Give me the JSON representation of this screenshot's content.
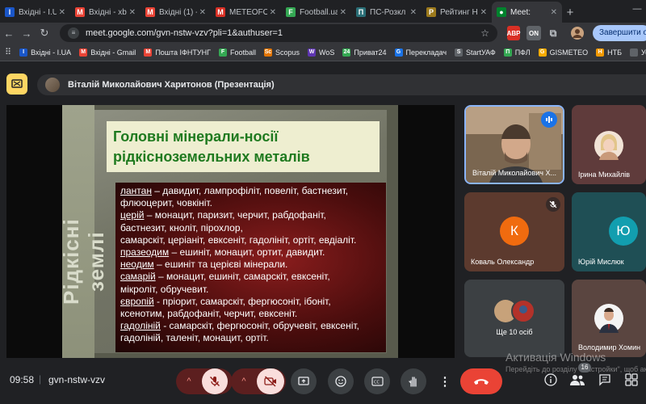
{
  "browser": {
    "tabs": [
      {
        "label": "Вхідні - I.UA",
        "icon_text": "I",
        "color": "#1a56c8"
      },
      {
        "label": "Вхідні - xb",
        "icon_text": "M",
        "color": "#ea4335"
      },
      {
        "label": "Вхідні (1) -",
        "icon_text": "M",
        "color": "#ea4335"
      },
      {
        "label": "METEOFOR",
        "icon_text": "M",
        "color": "#d93025"
      },
      {
        "label": "Football.ua",
        "icon_text": "F",
        "color": "#34a853"
      },
      {
        "label": "ПС-Розкл",
        "icon_text": "П",
        "color": "#2a6f77"
      },
      {
        "label": "Рейтинг НП",
        "icon_text": "Р",
        "color": "#9c7a1c"
      },
      {
        "label": "Meet: ",
        "icon_text": "●",
        "color": "#00832d"
      }
    ],
    "new_tab": "+",
    "url": "meet.google.com/gvn-nstw-vzv?pli=1&authuser=1",
    "end_call_pill": "Завершити онлайн",
    "extensions": [
      "ABP",
      "ON"
    ],
    "bookmarks": [
      {
        "label": "Вхідні - I.UA",
        "icon_text": "I",
        "color": "#1a56c8"
      },
      {
        "label": "Вхідні - Gmail",
        "icon_text": "M",
        "color": "#ea4335"
      },
      {
        "label": "Пошта ІФНТУНГ",
        "icon_text": "M",
        "color": "#ea4335"
      },
      {
        "label": "Football",
        "icon_text": "F",
        "color": "#34a853"
      },
      {
        "label": "Scopus",
        "icon_text": "Sc",
        "color": "#e37400"
      },
      {
        "label": "WoS",
        "icon_text": "W",
        "color": "#5e35b1"
      },
      {
        "label": "Приват24",
        "icon_text": "24",
        "color": "#34a853"
      },
      {
        "label": "Перекладач",
        "icon_text": "G",
        "color": "#1a73e8"
      },
      {
        "label": "StartУАФ",
        "icon_text": "S",
        "color": "#5f6368"
      },
      {
        "label": "ПФЛ",
        "icon_text": "П",
        "color": "#34a853"
      },
      {
        "label": "GISMETEO",
        "icon_text": "G",
        "color": "#f9ab00"
      },
      {
        "label": "НТБ",
        "icon_text": "Н",
        "color": "#f29900"
      },
      {
        "label": "Ус",
        "icon_text": "",
        "color": "#5f6368"
      }
    ]
  },
  "meet": {
    "presenter_label": "Віталій Миколайович Харитонов (Презентація)",
    "slide": {
      "side_title": "Рідкісні землі",
      "title": "Головні мінерали-носії рідкісноземельних металів",
      "lines": [
        {
          "u": "лантан",
          "t": " – давидит, лампрофіліт, повеліт, бастнезит,"
        },
        {
          "u": "",
          "t": "флюоцерит, човкініт."
        },
        {
          "u": "церій",
          "t": " – монацит, паризит, черчит, рабдофаніт,"
        },
        {
          "u": "",
          "t": "бастнезит, кноліт, пірохлор,"
        },
        {
          "u": "",
          "t": "самарскіт, церіаніт, евксеніт, гадолініт, ортіт, евдіаліт."
        },
        {
          "u": "празеодим",
          "t": " – ешиніт, монацит, ортит, давидит."
        },
        {
          "u": "неодим",
          "t": " – ешиніт та церієві мінерали."
        },
        {
          "u": "самарій",
          "t": " – монацит, ешиніт, самарскіт, евксеніт,"
        },
        {
          "u": "",
          "t": "мікроліт, обручевит."
        },
        {
          "u": "європій",
          "t": " - пріорит, самарскіт, фергюсоніт, ібоніт,"
        },
        {
          "u": "",
          "t": "ксенотим, рабдофаніт, черчит, евксеніт."
        },
        {
          "u": "гадоліній",
          "t": " - самарскіт, фергюсоніт, обручевіт, евксеніт,"
        },
        {
          "u": "",
          "t": "гадоліній, таленіт, монацит, ортіт."
        }
      ]
    },
    "participants": [
      {
        "name": "Віталій Миколайович Х...",
        "type": "video",
        "speaking": true
      },
      {
        "name": "Ірина Михайлів",
        "type": "photo"
      },
      {
        "name": "Коваль Олександр",
        "type": "letter",
        "letter": "К",
        "color": "#f06b0f",
        "muted": true
      },
      {
        "name": "Юрій Мислюк",
        "type": "letter",
        "letter": "Ю",
        "color": "#129eaf"
      },
      {
        "name": "Ще 10 осіб",
        "type": "group"
      },
      {
        "name": "Володимир Хомин",
        "type": "photo"
      }
    ],
    "clock": "09:58",
    "meeting_code": "gvn-nstw-vzv",
    "participants_count": "16",
    "watermark_title": "Активація Windows",
    "watermark_sub": "Перейдіть до розділу \"Настройки\", щоб активувати Windows."
  }
}
